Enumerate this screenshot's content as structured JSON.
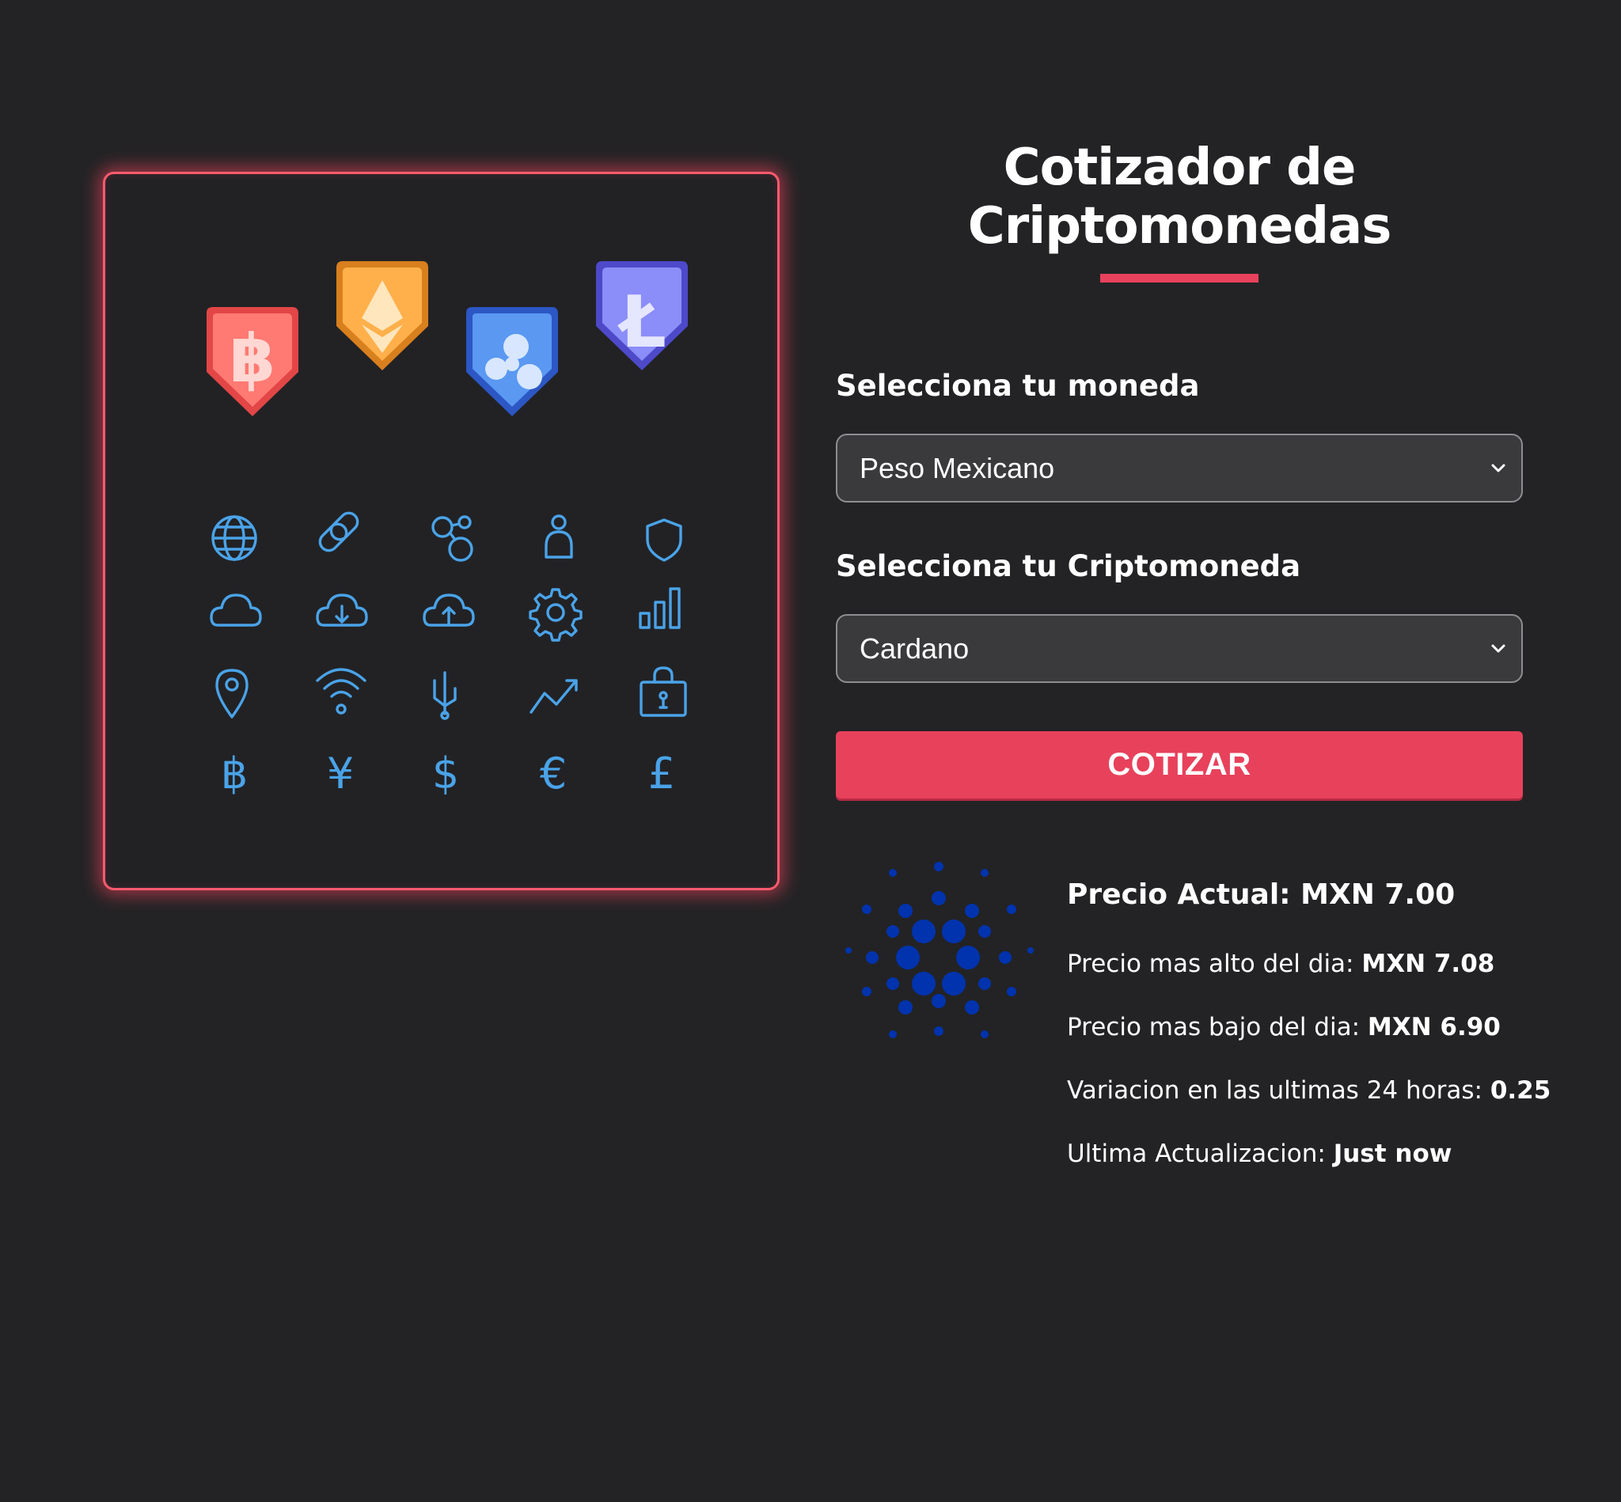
{
  "header": {
    "title_line1": "Cotizador de",
    "title_line2": "Criptomonedas"
  },
  "form": {
    "currency_label": "Selecciona tu moneda",
    "currency_value": "Peso Mexicano",
    "crypto_label": "Selecciona tu Criptomoneda",
    "crypto_value": "Cardano",
    "submit_label": "COTIZAR"
  },
  "result": {
    "current_price_label": "Precio Actual:",
    "current_price_value": "MXN 7.00",
    "high_label": "Precio mas alto del dia:",
    "high_value": "MXN 7.08",
    "low_label": "Precio mas bajo del dia:",
    "low_value": "MXN 6.90",
    "change_label": "Variacion en las ultimas 24 horas:",
    "change_value": "0.25",
    "updated_label": "Ultima Actualizacion:",
    "updated_value": "Just now"
  },
  "illustration": {
    "badges": [
      "bitcoin-badge-icon",
      "ethereum-badge-icon",
      "ripple-badge-icon",
      "litecoin-badge-icon"
    ],
    "icons": [
      "globe-icon",
      "link-icon",
      "network-icon",
      "user-icon",
      "shield-icon",
      "cloud-icon",
      "cloud-download-icon",
      "cloud-upload-icon",
      "gear-icon",
      "bar-chart-icon",
      "location-pin-icon",
      "wifi-icon",
      "usb-icon",
      "trend-up-icon",
      "padlock-icon",
      "bitcoin-icon",
      "yen-icon",
      "dollar-icon",
      "euro-icon",
      "pound-icon"
    ],
    "icon_color": "#4aa3e8",
    "glow_color": "#ff5a6e"
  },
  "colors": {
    "accent": "#e8415c",
    "background": "#232325",
    "cardano_logo": "#0033ad"
  },
  "coin_logo": "cardano-logo-icon"
}
